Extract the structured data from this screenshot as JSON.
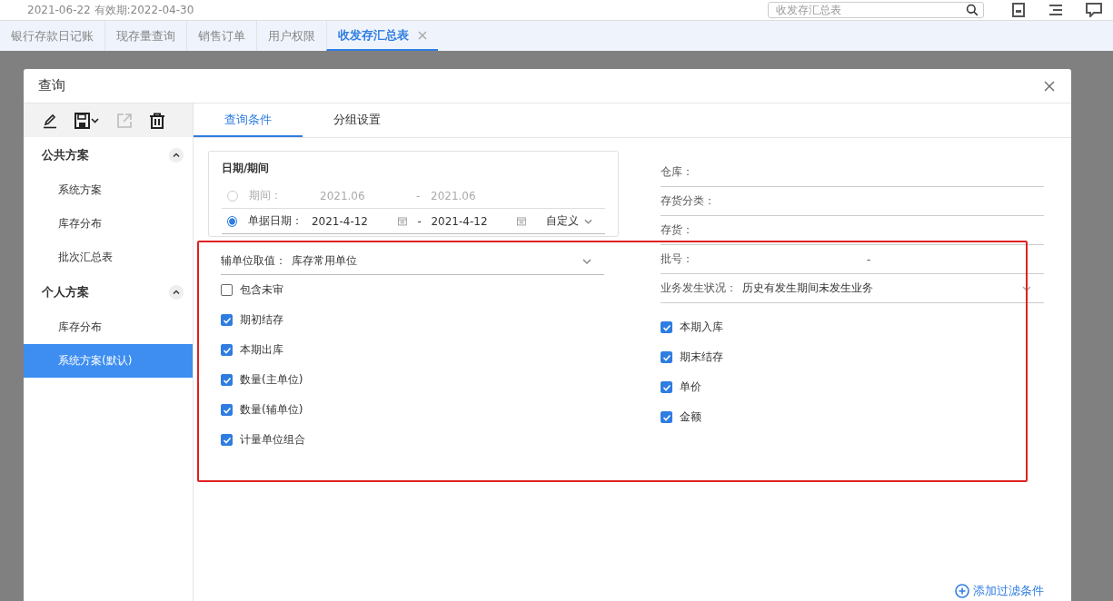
{
  "header": {
    "info": "2021-06-22   有效期:2022-04-30",
    "search": {
      "placeholder": "收发存汇总表"
    }
  },
  "tabs": [
    {
      "label": "银行存款日记账",
      "selected": false
    },
    {
      "label": "现存量查询",
      "selected": false
    },
    {
      "label": "销售订单",
      "selected": false
    },
    {
      "label": "用户权限",
      "selected": false
    },
    {
      "label": "收发存汇总表",
      "selected": true
    }
  ],
  "dialog": {
    "title": "查询",
    "toolbar": [
      {
        "kind": "edit",
        "disabled": false
      },
      {
        "kind": "save",
        "disabled": false
      },
      {
        "kind": "export",
        "disabled": true
      },
      {
        "kind": "delete",
        "disabled": false
      }
    ],
    "scheme_groups": [
      {
        "title": "公共方案",
        "expanded": true,
        "items": [
          {
            "label": "系统方案",
            "selected": false
          },
          {
            "label": "库存分布",
            "selected": false
          },
          {
            "label": "批次汇总表",
            "selected": false
          }
        ]
      },
      {
        "title": "个人方案",
        "expanded": true,
        "items": [
          {
            "label": "库存分布",
            "selected": false
          },
          {
            "label": "系统方案(默认)",
            "selected": true
          }
        ]
      }
    ],
    "tabs": [
      {
        "label": "查询条件",
        "selected": true
      },
      {
        "label": "分组设置",
        "selected": false
      }
    ],
    "date_section": {
      "title": "日期/期间",
      "rows": [
        {
          "kind": "period",
          "label": "期间：",
          "selected": false,
          "from": "2021.06",
          "separator": "-",
          "to": "2021.06"
        },
        {
          "kind": "date",
          "label": "单据日期：",
          "selected": true,
          "from": "2021-4-12",
          "separator": "-",
          "to": "2021-4-12",
          "mode": "自定义"
        }
      ]
    },
    "unit_field": {
      "label": "辅单位取值：",
      "value": "库存常用单位"
    },
    "left_checks": [
      {
        "label": "包含未审",
        "checked": false
      },
      {
        "label": "期初结存",
        "checked": true
      },
      {
        "label": "本期出库",
        "checked": true
      },
      {
        "label": "数量(主单位)",
        "checked": true
      },
      {
        "label": "数量(辅单位)",
        "checked": true
      },
      {
        "label": "计量单位组合",
        "checked": true
      }
    ],
    "right_fields": [
      {
        "kind": "text",
        "label": "仓库："
      },
      {
        "kind": "text",
        "label": "存货分类："
      },
      {
        "kind": "text",
        "label": "存货："
      },
      {
        "kind": "range",
        "label": "批号：",
        "separator": "-"
      },
      {
        "kind": "select",
        "label": "业务发生状况：",
        "value": "历史有发生期间未发生业务"
      }
    ],
    "right_checks": [
      {
        "label": "本期入库",
        "checked": true
      },
      {
        "label": "期末结存",
        "checked": true
      },
      {
        "label": "单价",
        "checked": true
      },
      {
        "label": "金额",
        "checked": true
      }
    ],
    "add_filter": "添加过滤条件"
  }
}
